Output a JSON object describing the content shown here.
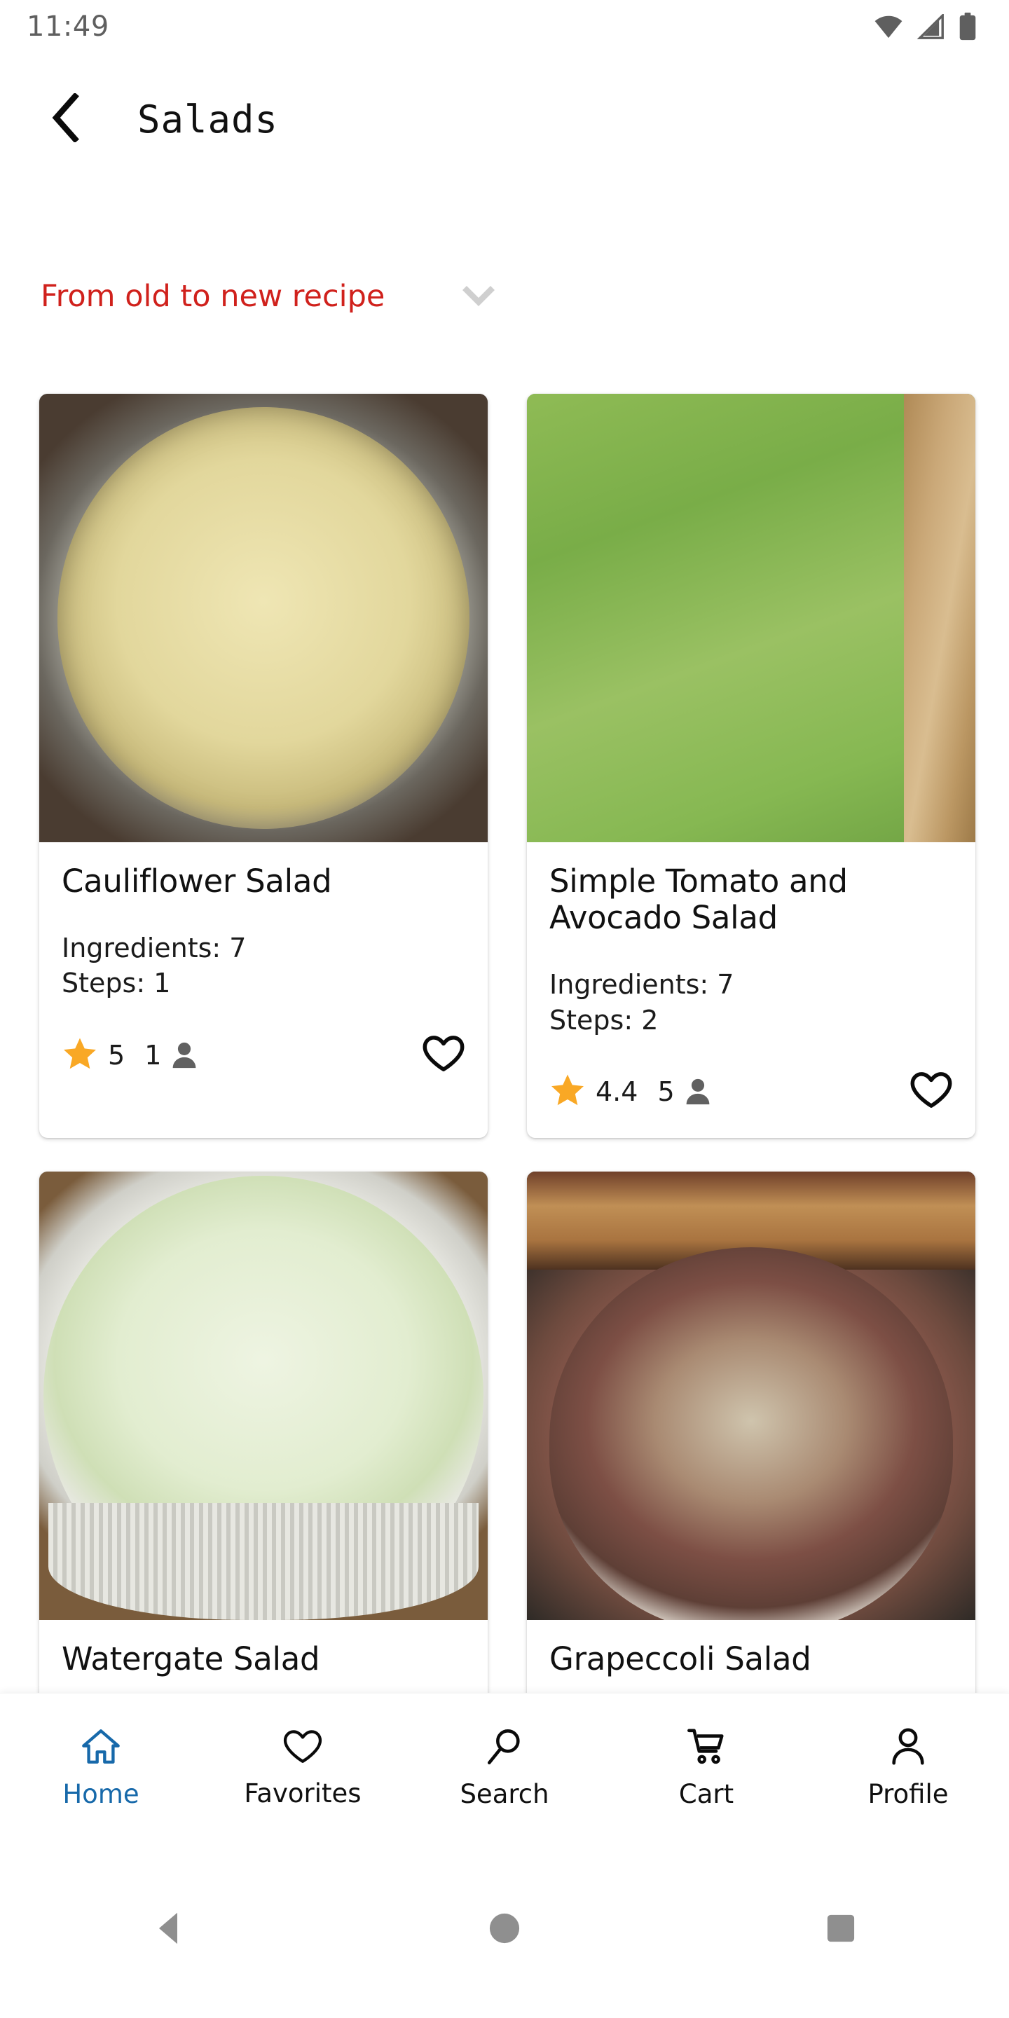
{
  "status_bar": {
    "time": "11:49",
    "icons": [
      "wifi-icon",
      "signal-icon",
      "battery-icon"
    ],
    "icon_color": "#5f5f5f"
  },
  "app_bar": {
    "back_icon": "chevron-left-icon",
    "title": "Salads"
  },
  "sort": {
    "label": "From old to new recipe",
    "chevron_icon": "chevron-down-icon",
    "color": "#d0211c"
  },
  "colors": {
    "accent_red": "#d0211c",
    "star_amber": "#f9a825",
    "active_nav_blue": "#1769aa",
    "person_gray": "#616161",
    "status_gray": "#5f5f5f"
  },
  "labels": {
    "ingredients_prefix": "Ingredients: ",
    "steps_prefix": "Steps: "
  },
  "recipes": [
    {
      "title": "Cauliflower Salad",
      "ingredients": "Ingredients: 7",
      "steps": "Steps: 1",
      "rating": "5",
      "people": "1",
      "photo": "cauliflower-salad-photo",
      "favorite_icon": "heart-outline-icon"
    },
    {
      "title": "Simple Tomato and Avocado Salad",
      "ingredients": "Ingredients: 7",
      "steps": "Steps: 2",
      "rating": "4.4",
      "people": "5",
      "photo": "tomato-avocado-salad-photo",
      "favorite_icon": "heart-outline-icon"
    },
    {
      "title": "Watergate Salad",
      "ingredients": "",
      "steps": "",
      "rating": "",
      "people": "",
      "photo": "watergate-salad-photo",
      "favorite_icon": "heart-outline-icon"
    },
    {
      "title": "Grapeccoli Salad",
      "ingredients": "",
      "steps": "",
      "rating": "",
      "people": "",
      "photo": "grapeccoli-salad-photo",
      "favorite_icon": "heart-outline-icon"
    }
  ],
  "bottom_nav": {
    "items": [
      {
        "label": "Home",
        "icon": "home-icon",
        "active": true
      },
      {
        "label": "Favorites",
        "icon": "heart-icon",
        "active": false
      },
      {
        "label": "Search",
        "icon": "search-icon",
        "active": false
      },
      {
        "label": "Cart",
        "icon": "cart-icon",
        "active": false
      },
      {
        "label": "Profile",
        "icon": "person-icon",
        "active": false
      }
    ]
  },
  "system_nav": {
    "back": "triangle-back-icon",
    "home": "circle-home-icon",
    "recents": "square-recents-icon",
    "color": "#8f8f8f"
  }
}
